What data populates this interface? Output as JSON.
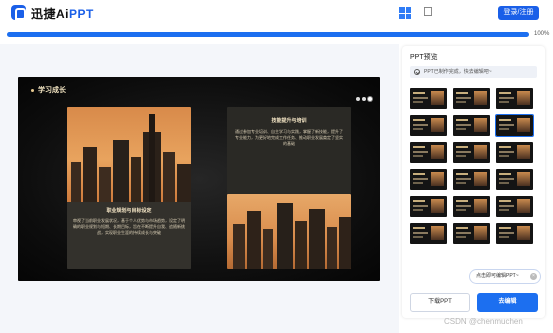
{
  "header": {
    "logo_icon": "p-logo-icon",
    "brand_main": "迅捷Ai",
    "brand_accent": "PPT",
    "platform_icons": [
      "windows-icon",
      "apple-icon"
    ],
    "login_label": "登录/注册",
    "accent_color": "#1a5fe8"
  },
  "progress": {
    "value": 1.0,
    "label": "100%"
  },
  "slide": {
    "title": "学习成长",
    "dots": 3,
    "left_card": {
      "title": "职业规划与目标设定",
      "body": "审视了当前职业发展状况，基于个人优势与市场趋势，设定了明确的职业规划与短期、长期目标，旨在不断提升自我、追随新挑战，实现职业生涯的持续成长与突破"
    },
    "right_card": {
      "title": "技能提升与培训",
      "body": "通过参加专业培训、自主学习与实践，掌握了新技能，提升了专业能力，为更好地完成工作任务、推动职业发展奠定了坚实的基础"
    }
  },
  "panel": {
    "title": "PPT预览",
    "status_icon": "check-circle-icon",
    "status_text": "PPT已制作完成，快去编辑吧~",
    "thumb_count": 18,
    "selected_thumb": 5
  },
  "tooltip": {
    "text": "点击即可编辑PPT~",
    "close_icon": "close-icon"
  },
  "actions": {
    "download_label": "下载PPT",
    "edit_label": "去编辑"
  },
  "watermark": "CSDN @chenmuchen"
}
